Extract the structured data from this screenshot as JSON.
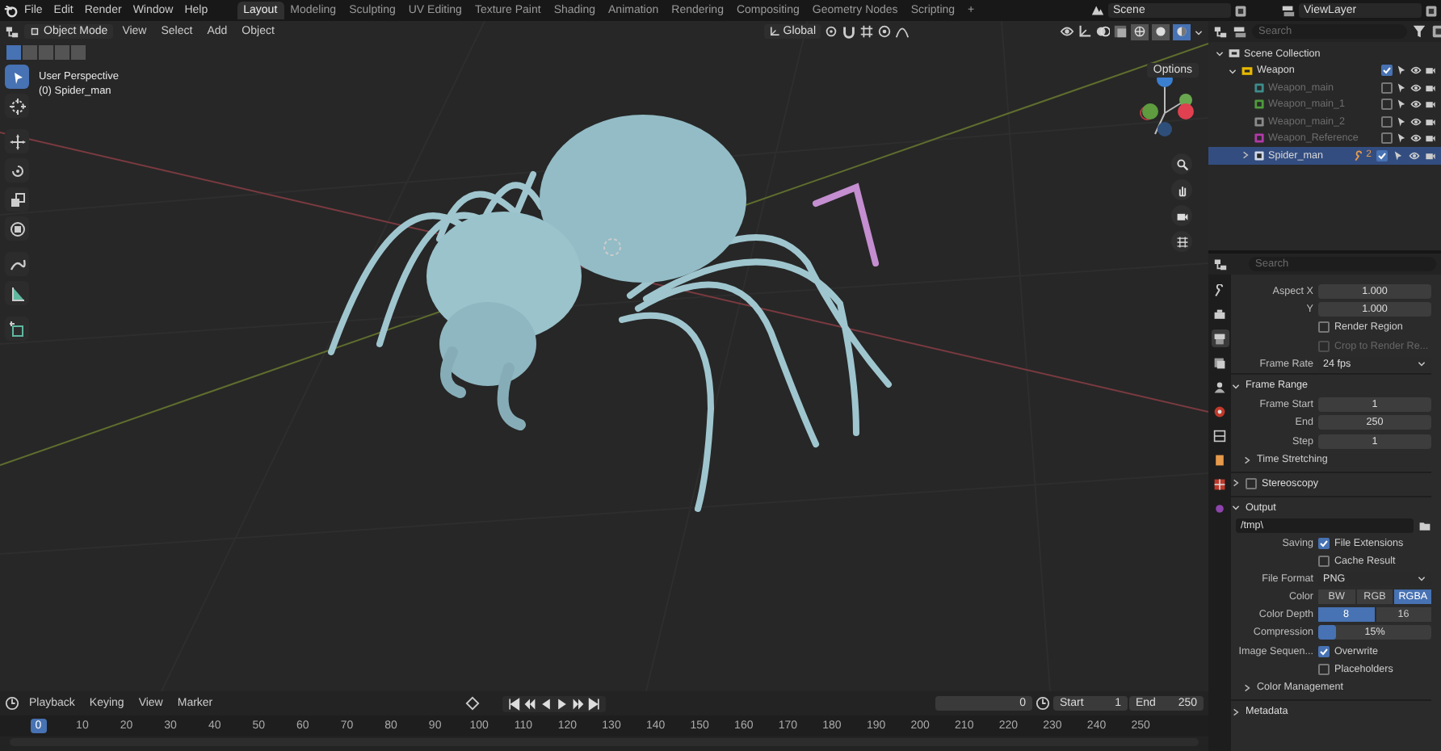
{
  "menu": [
    "File",
    "Edit",
    "Render",
    "Window",
    "Help"
  ],
  "workspaces": [
    {
      "label": "Layout",
      "selected": true
    },
    {
      "label": "Modeling",
      "selected": false
    },
    {
      "label": "Sculpting",
      "selected": false
    },
    {
      "label": "UV Editing",
      "selected": false
    },
    {
      "label": "Texture Paint",
      "selected": false
    },
    {
      "label": "Shading",
      "selected": false
    },
    {
      "label": "Animation",
      "selected": false
    },
    {
      "label": "Rendering",
      "selected": false
    },
    {
      "label": "Compositing",
      "selected": false
    },
    {
      "label": "Geometry Nodes",
      "selected": false
    },
    {
      "label": "Scripting",
      "selected": false
    }
  ],
  "add_workspace": "+",
  "scene": "Scene",
  "view_layer": "ViewLayer",
  "viewport": {
    "mode": "Object Mode",
    "menus": [
      "View",
      "Select",
      "Add",
      "Object"
    ],
    "orientation": "Global",
    "select_modes": [
      {
        "selected": true
      },
      {
        "selected": false
      },
      {
        "selected": false
      },
      {
        "selected": false
      },
      {
        "selected": false
      }
    ],
    "shading": [
      {
        "selected": false
      },
      {
        "selected": false
      },
      {
        "selected": true
      }
    ],
    "perspective": "User Perspective",
    "object_label": "(0) Spider_man",
    "options": "Options",
    "tools": [
      {
        "selected": true
      },
      {
        "selected": false
      },
      {
        "selected": false
      },
      {
        "selected": false
      },
      {
        "selected": false
      },
      {
        "selected": false
      },
      {
        "selected": false
      },
      {
        "selected": false
      },
      {
        "selected": false
      }
    ]
  },
  "outliner": {
    "search_placeholder": "Search",
    "tree": [
      {
        "label": "Scene Collection",
        "selected": false,
        "expanded": true,
        "children": [
          {
            "label": "Weapon",
            "selected": false,
            "expanded": true,
            "checked": true,
            "children": [
              {
                "label": "Weapon_main",
                "selected": false,
                "checked": false,
                "color": "#3e8c8c"
              },
              {
                "label": "Weapon_main_1",
                "selected": false,
                "checked": false,
                "color": "#4f9a3c"
              },
              {
                "label": "Weapon_main_2",
                "selected": false,
                "checked": false,
                "color": "#8a8a8a"
              },
              {
                "label": "Weapon_Reference",
                "selected": false,
                "checked": false,
                "color": "#b23aa8"
              },
              {
                "label": "Spider_man",
                "selected": true,
                "checked": true,
                "color": "#cfd8e6",
                "badge": "2",
                "expanded": false
              }
            ]
          }
        ]
      }
    ]
  },
  "properties": {
    "search_placeholder": "Search",
    "tabs": [
      {
        "selected": false
      },
      {
        "selected": false
      },
      {
        "selected": true
      },
      {
        "selected": false
      },
      {
        "selected": false
      },
      {
        "selected": false
      },
      {
        "selected": false
      },
      {
        "selected": false
      },
      {
        "selected": false
      },
      {
        "selected": false
      }
    ],
    "rows": [
      {
        "kind": "field",
        "label": "Aspect X",
        "value": "1.000"
      },
      {
        "kind": "field",
        "label": "Y",
        "value": "1.000"
      },
      {
        "kind": "checkbox",
        "label": "Render Region",
        "checked": false,
        "disabled": false
      },
      {
        "kind": "checkbox",
        "label": "Crop to Render Re...",
        "checked": false,
        "disabled": true
      },
      {
        "kind": "dropdown",
        "label": "Frame Rate",
        "value": "24 fps"
      },
      {
        "kind": "section",
        "label": "Frame Range",
        "expanded": true
      },
      {
        "kind": "field",
        "label": "Frame Start",
        "value": "1"
      },
      {
        "kind": "field",
        "label": "End",
        "value": "250"
      },
      {
        "kind": "field",
        "label": "Step",
        "value": "1"
      },
      {
        "kind": "subsection",
        "label": "Time Stretching",
        "expanded": false
      },
      {
        "kind": "section",
        "label": "Stereoscopy",
        "expanded": false,
        "checked": false
      },
      {
        "kind": "section",
        "label": "Output",
        "expanded": true
      },
      {
        "kind": "path",
        "value": "/tmp\\"
      },
      {
        "kind": "checkbox",
        "caption": "Saving",
        "label": "File Extensions",
        "checked": true,
        "disabled": false
      },
      {
        "kind": "checkbox",
        "label": "Cache Result",
        "checked": false,
        "disabled": false
      },
      {
        "kind": "dropdown",
        "label": "File Format",
        "value": "PNG"
      },
      {
        "kind": "segmented",
        "label": "Color",
        "options": [
          {
            "label": "BW",
            "selected": false
          },
          {
            "label": "RGB",
            "selected": false
          },
          {
            "label": "RGBA",
            "selected": true
          }
        ]
      },
      {
        "kind": "segmented",
        "label": "Color Depth",
        "options": [
          {
            "label": "8",
            "selected": true
          },
          {
            "label": "16",
            "selected": false
          }
        ]
      },
      {
        "kind": "slider",
        "label": "Compression",
        "value": "15%",
        "level": 0.15
      },
      {
        "kind": "checkbox",
        "caption": "Image Sequen...",
        "label": "Overwrite",
        "checked": true,
        "disabled": false
      },
      {
        "kind": "checkbox",
        "label": "Placeholders",
        "checked": false,
        "disabled": false
      },
      {
        "kind": "subsection",
        "label": "Color Management",
        "expanded": false
      },
      {
        "kind": "section",
        "label": "Metadata",
        "expanded": false
      }
    ]
  },
  "timeline": {
    "menus": [
      "Playback",
      "Keying",
      "View",
      "Marker"
    ],
    "current_frame": "0",
    "start_label": "Start",
    "start": "1",
    "end_label": "End",
    "end": "250",
    "playhead": "0",
    "ticks": [
      "10",
      "20",
      "30",
      "40",
      "50",
      "60",
      "70",
      "80",
      "90",
      "100",
      "110",
      "120",
      "130",
      "140",
      "150",
      "160",
      "170",
      "180",
      "190",
      "200",
      "210",
      "220",
      "230",
      "240",
      "250"
    ]
  }
}
